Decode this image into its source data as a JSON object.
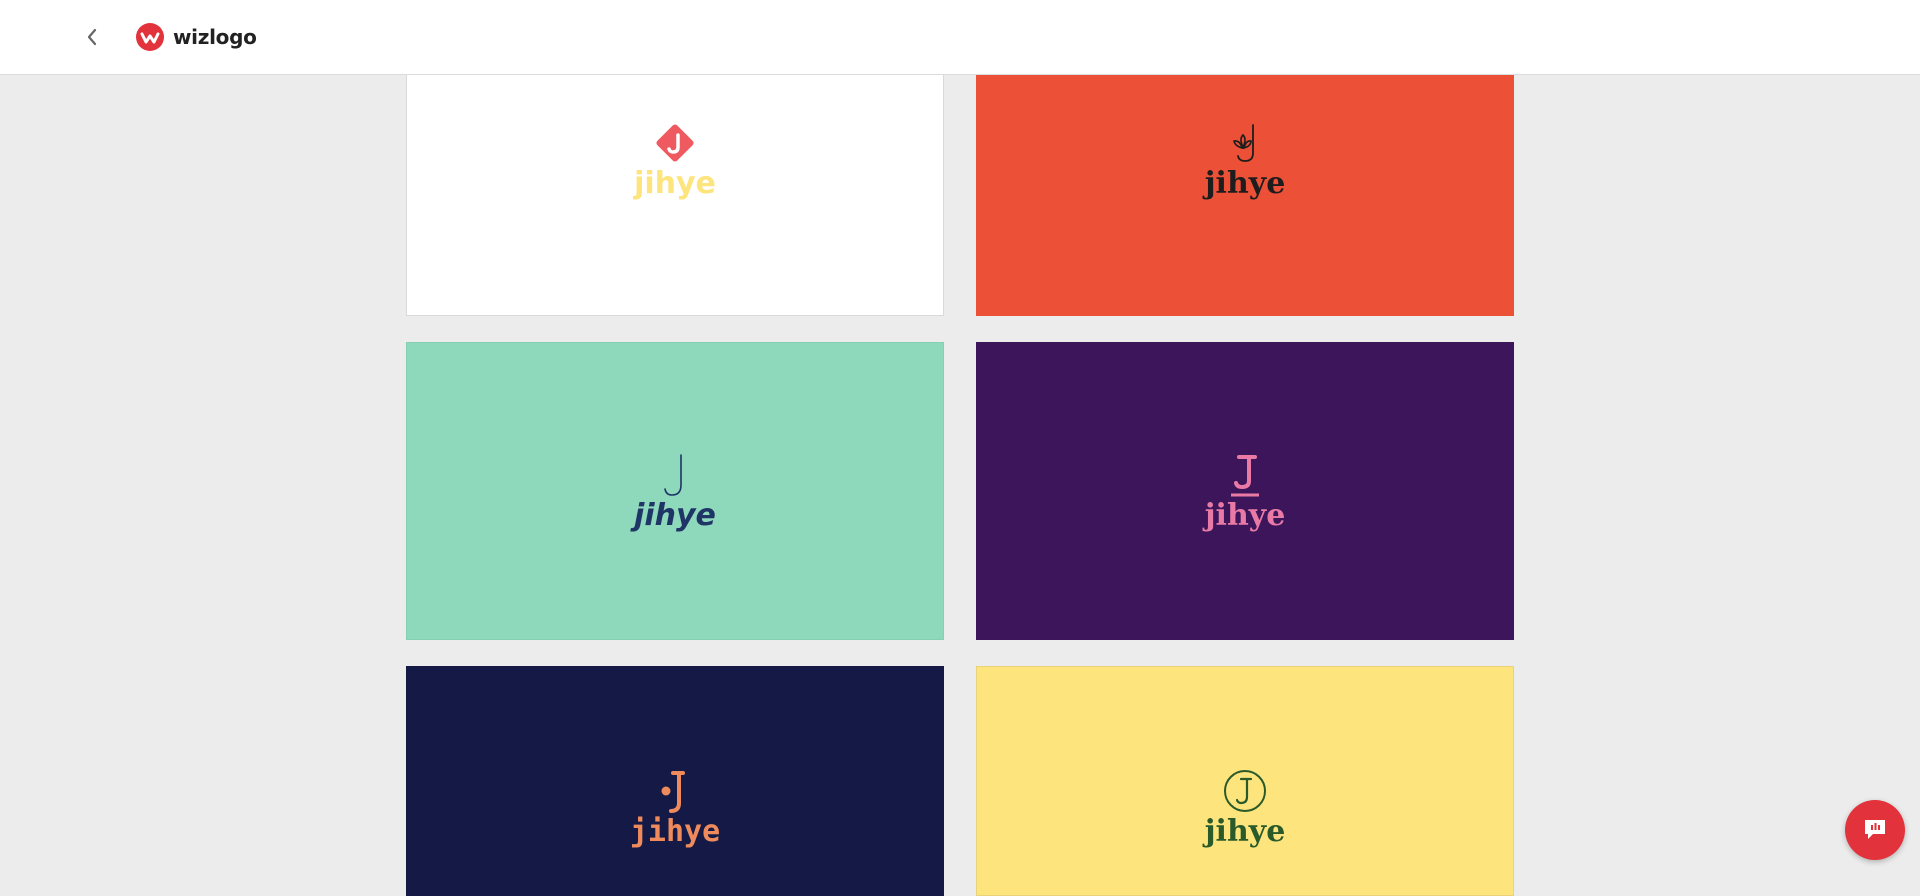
{
  "header": {
    "brand_name": "wizlogo"
  },
  "cards": [
    {
      "text": "jihye",
      "text_color": "#fde47d",
      "mark_color": "#ee5a5f",
      "icon": "diamond-j-icon"
    },
    {
      "text": "jihye",
      "text_color": "#1d1d1d",
      "mark_color": "#1d1d1d",
      "icon": "leaf-j-icon"
    },
    {
      "text": "jihye",
      "text_color": "#1f3566",
      "mark_color": "#1f3566",
      "icon": "hook-j-icon"
    },
    {
      "text": "jihye",
      "text_color": "#e97aa6",
      "mark_color": "#e97aa6",
      "icon": "serif-j-underline-icon"
    },
    {
      "text": "jihye",
      "text_color": "#ee8a5c",
      "mark_color": "#ee8a5c",
      "icon": "dot-j-icon"
    },
    {
      "text": "jihye",
      "text_color": "#2a5a2a",
      "mark_color": "#2a5a2a",
      "icon": "circle-j-icon"
    }
  ],
  "colors": {
    "brand": "#e2323b",
    "page_bg": "#ececec"
  }
}
